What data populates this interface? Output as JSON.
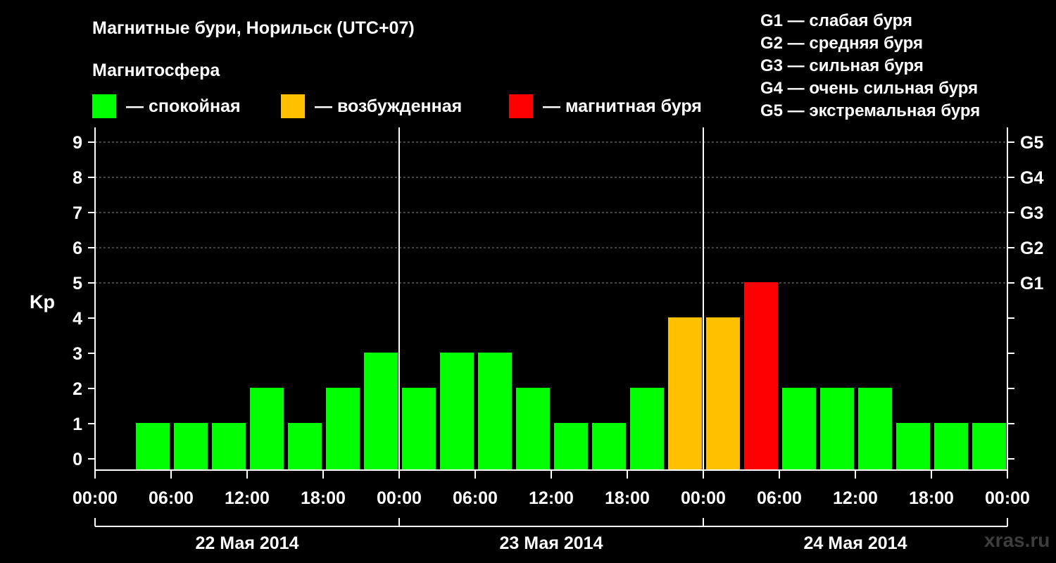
{
  "title": "Магнитные бури, Норильск (UTC+07)",
  "subtitle": "Магнитосфера",
  "legend": [
    {
      "label": "— спокойная",
      "color": "#00ff00"
    },
    {
      "label": "— возбужденная",
      "color": "#ffc000"
    },
    {
      "label": "— магнитная буря",
      "color": "#ff0000"
    }
  ],
  "storm_levels": [
    "G1 — слабая буря",
    "G2 — средняя буря",
    "G3 — сильная буря",
    "G4 — очень сильная буря",
    "G5 — экстремальная буря"
  ],
  "watermark": "xras.ru",
  "chart_data": {
    "type": "bar",
    "ylabel": "Kp",
    "ylim": [
      0,
      9
    ],
    "y_ticks": [
      0,
      1,
      2,
      3,
      4,
      5,
      6,
      7,
      8,
      9
    ],
    "right_axis_labels": [
      {
        "kp": 5,
        "label": "G1"
      },
      {
        "kp": 6,
        "label": "G2"
      },
      {
        "kp": 7,
        "label": "G3"
      },
      {
        "kp": 8,
        "label": "G4"
      },
      {
        "kp": 9,
        "label": "G5"
      }
    ],
    "grid": "horizontal dashed at Kp 5–9",
    "x_tick_labels": [
      "00:00",
      "06:00",
      "12:00",
      "18:00",
      "00:00",
      "06:00",
      "12:00",
      "18:00",
      "00:00",
      "06:00",
      "12:00",
      "18:00",
      "00:00"
    ],
    "days": [
      "22 Мая 2014",
      "23 Мая 2014",
      "24 Мая 2014"
    ],
    "interval_hours": 3,
    "values": [
      null,
      1,
      1,
      1,
      2,
      1,
      2,
      3,
      2,
      3,
      3,
      2,
      1,
      1,
      2,
      4,
      4,
      5,
      2,
      2,
      2,
      1,
      1,
      1
    ],
    "colors": {
      "quiet": "#00ff00",
      "disturbed": "#ffc000",
      "storm": "#ff0000"
    },
    "thresholds": {
      "disturbed": 4,
      "storm": 5
    }
  }
}
